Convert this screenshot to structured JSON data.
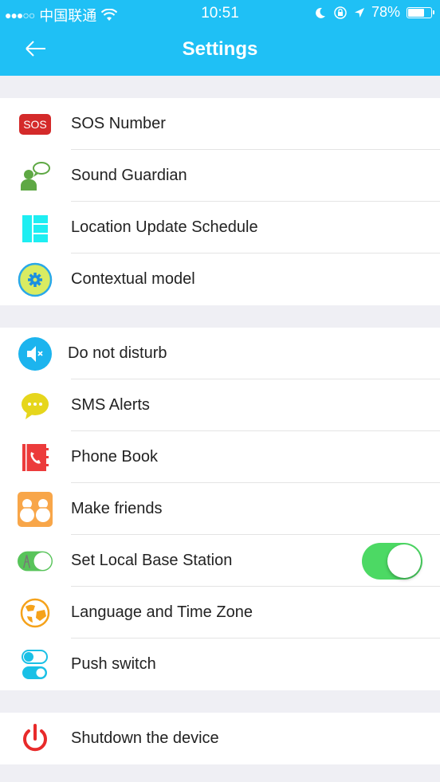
{
  "status_bar": {
    "signal": "●●●○○",
    "carrier": "中国联通",
    "time": "10:51",
    "battery_percent": "78%",
    "battery_level": 0.78
  },
  "header": {
    "title": "Settings",
    "back_icon": "arrow-left-icon"
  },
  "colors": {
    "accent": "#1fc0f5",
    "toggle_on": "#4cd964",
    "background": "#efeff4"
  },
  "groups": [
    {
      "items": [
        {
          "label": "SOS Number",
          "icon": "sos-icon",
          "icon_text": "SOS"
        },
        {
          "label": "Sound Guardian",
          "icon": "sound-guardian-icon"
        },
        {
          "label": "Location Update Schedule",
          "icon": "schedule-icon"
        },
        {
          "label": "Contextual model",
          "icon": "gear-icon"
        }
      ]
    },
    {
      "items": [
        {
          "label": "Do not disturb",
          "icon": "mute-icon"
        },
        {
          "label": "SMS Alerts",
          "icon": "chat-bubble-icon"
        },
        {
          "label": "Phone Book",
          "icon": "phone-book-icon"
        },
        {
          "label": "Make friends",
          "icon": "snowman-friends-icon"
        },
        {
          "label": "Set Local Base Station",
          "icon": "base-station-icon",
          "toggle": true
        },
        {
          "label": "Language and Time Zone",
          "icon": "globe-icon"
        },
        {
          "label": "Push switch",
          "icon": "push-switch-icon"
        }
      ]
    },
    {
      "items": [
        {
          "label": "Shutdown the device",
          "icon": "power-icon"
        }
      ]
    }
  ]
}
